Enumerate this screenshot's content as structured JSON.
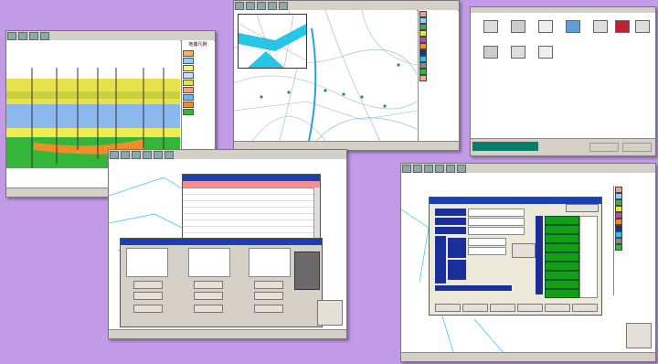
{
  "colors": {
    "background": "#c39ae8",
    "green": "#12a012",
    "navy": "#1a2f9a",
    "cyan": "#26c6e8"
  },
  "screens": [
    {
      "name": "geological-cross-section-viewer",
      "legend_title": "地層凡例"
    },
    {
      "name": "map-viewer"
    },
    {
      "name": "file-browser",
      "files": [
        "",
        "",
        "",
        "",
        "",
        "",
        "",
        ""
      ]
    },
    {
      "name": "record-list-viewer"
    },
    {
      "name": "data-entry-form"
    }
  ]
}
